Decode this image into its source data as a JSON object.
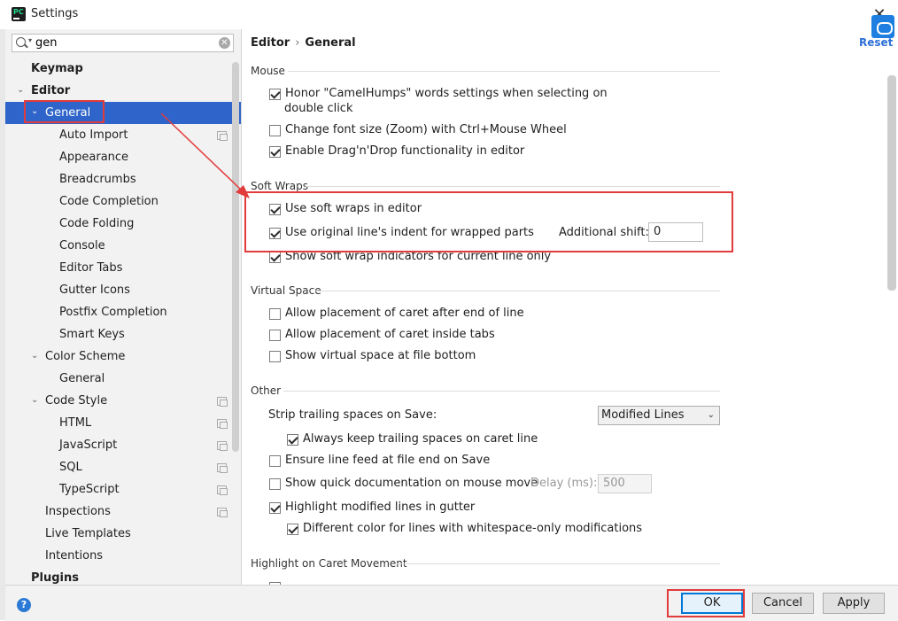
{
  "window": {
    "title": "Settings",
    "app_icon_text": "PC"
  },
  "search": {
    "value": "gen"
  },
  "sidebar": {
    "items": [
      {
        "label": "Keymap"
      },
      {
        "label": "Editor"
      },
      {
        "label": "General"
      },
      {
        "label": "Auto Import"
      },
      {
        "label": "Appearance"
      },
      {
        "label": "Breadcrumbs"
      },
      {
        "label": "Code Completion"
      },
      {
        "label": "Code Folding"
      },
      {
        "label": "Console"
      },
      {
        "label": "Editor Tabs"
      },
      {
        "label": "Gutter Icons"
      },
      {
        "label": "Postfix Completion"
      },
      {
        "label": "Smart Keys"
      },
      {
        "label": "Color Scheme"
      },
      {
        "label": "General"
      },
      {
        "label": "Code Style"
      },
      {
        "label": "HTML"
      },
      {
        "label": "JavaScript"
      },
      {
        "label": "SQL"
      },
      {
        "label": "TypeScript"
      },
      {
        "label": "Inspections"
      },
      {
        "label": "Live Templates"
      },
      {
        "label": "Intentions"
      },
      {
        "label": "Plugins"
      }
    ]
  },
  "breadcrumb": {
    "parent": "Editor",
    "separator": "›",
    "current": "General"
  },
  "reset": {
    "label": "Reset"
  },
  "mouse": {
    "title": "Mouse",
    "camelhumps_line1": "Honor \"CamelHumps\" words settings when selecting on",
    "camelhumps_line2": "double click",
    "zoom": "Change font size (Zoom) with Ctrl+Mouse Wheel",
    "dragdrop": "Enable Drag'n'Drop functionality in editor"
  },
  "soft_wraps": {
    "title": "Soft Wraps",
    "use_soft_wraps": "Use soft wraps in editor",
    "original_indent": "Use original line's indent for wrapped parts",
    "additional_shift_label": "Additional shift:",
    "additional_shift_value": "0",
    "show_indicators": "Show soft wrap indicators for current line only"
  },
  "virtual_space": {
    "title": "Virtual Space",
    "after_end": "Allow placement of caret after end of line",
    "inside_tabs": "Allow placement of caret inside tabs",
    "file_bottom": "Show virtual space at file bottom"
  },
  "other": {
    "title": "Other",
    "strip_label": "Strip trailing spaces on Save:",
    "strip_value": "Modified Lines",
    "keep_trailing": "Always keep trailing spaces on caret line",
    "line_feed": "Ensure line feed at file end on Save",
    "quick_doc": "Show quick documentation on mouse move",
    "delay_label": "Delay (ms):",
    "delay_value": "500",
    "highlight_modified": "Highlight modified lines in gutter",
    "diff_color": "Different color for lines with whitespace-only modifications"
  },
  "caret_movement": {
    "title": "Highlight on Caret Movement"
  },
  "buttons": {
    "ok": "OK",
    "cancel": "Cancel",
    "apply": "Apply",
    "help": "?"
  },
  "colors": {
    "selection": "#2f65ca",
    "annotation_red": "#e23b3b",
    "link_blue": "#2d6fd6"
  }
}
